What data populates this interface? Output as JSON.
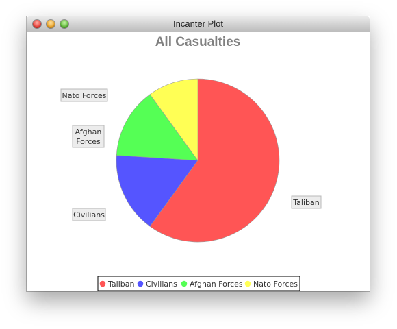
{
  "window": {
    "title": "Incanter Plot"
  },
  "colors": {
    "taliban": "#FF5555",
    "civilians": "#5555FF",
    "afghan": "#55FF55",
    "nato": "#FFFF55",
    "title": "#808080"
  },
  "chart_data": {
    "type": "pie",
    "title": "All Casualties",
    "slices": [
      {
        "label": "Taliban",
        "value": 60
      },
      {
        "label": "Civilians",
        "value": 16
      },
      {
        "label": "Afghan Forces",
        "value": 14
      },
      {
        "label": "Nato Forces",
        "value": 10
      }
    ],
    "legend": {
      "placement": "bottom",
      "entries": [
        "Taliban",
        "Civilians",
        "Afghan Forces",
        "Nato Forces"
      ]
    },
    "labels": {
      "taliban": "Taliban",
      "civilians": "Civilians",
      "afghan_line1": "Afghan",
      "afghan_line2": "Forces",
      "nato": "Nato Forces"
    }
  }
}
